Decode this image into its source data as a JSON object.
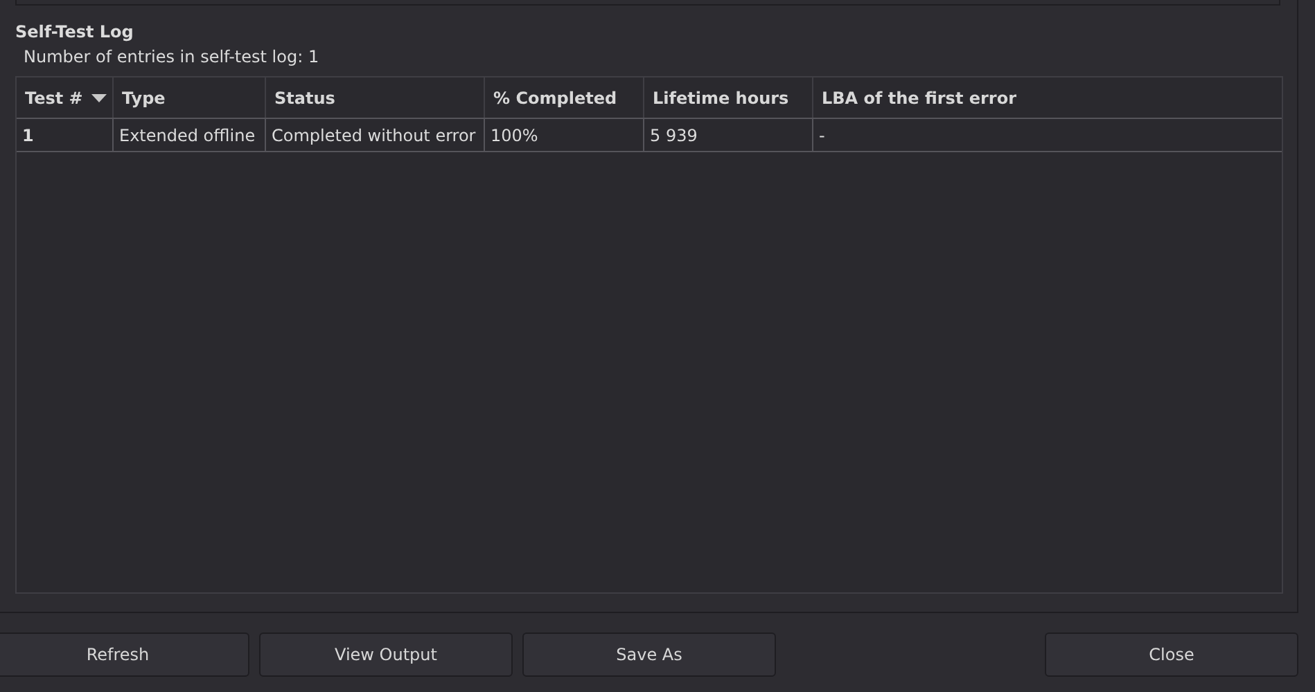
{
  "section_title": "Self-Test Log",
  "entries_label": "Number of entries in self-test log: 1",
  "table": {
    "columns": [
      {
        "label": "Test #",
        "sorted": true
      },
      {
        "label": "Type",
        "sorted": false
      },
      {
        "label": "Status",
        "sorted": false
      },
      {
        "label": "% Completed",
        "sorted": false
      },
      {
        "label": "Lifetime hours",
        "sorted": false
      },
      {
        "label": "LBA of the first error",
        "sorted": false
      }
    ],
    "rows": [
      [
        "1",
        "Extended offline",
        "Completed without error",
        "100%",
        "5 939",
        "-"
      ]
    ]
  },
  "buttons": [
    {
      "label": "Refresh",
      "kind": "left"
    },
    {
      "label": "View Output",
      "kind": "left"
    },
    {
      "label": "Save As",
      "kind": "left"
    },
    {
      "label": "Close",
      "kind": "right"
    }
  ]
}
